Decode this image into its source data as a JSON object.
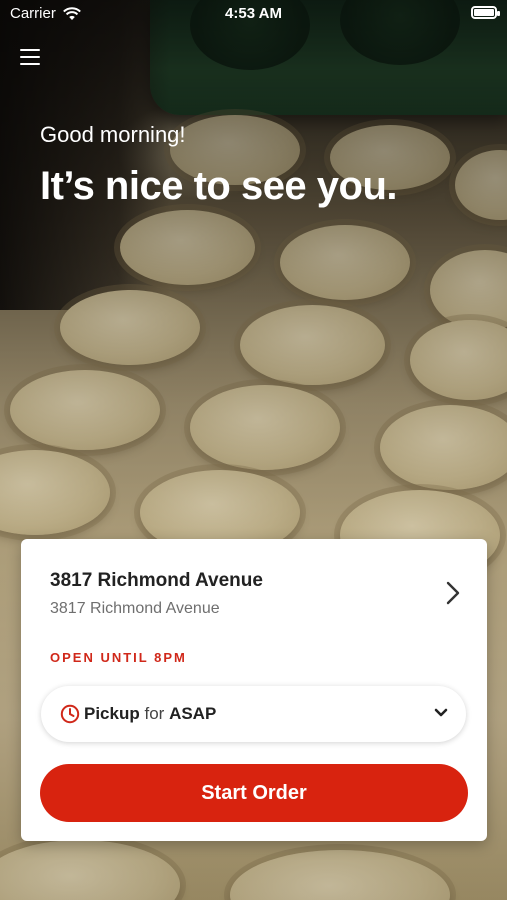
{
  "status_bar": {
    "carrier": "Carrier",
    "time": "4:53 AM"
  },
  "header": {
    "menu_icon": "hamburger-menu-icon"
  },
  "greeting": {
    "line1": "Good morning!",
    "line2": "It’s nice to see you."
  },
  "location_card": {
    "name": "3817 Richmond Avenue",
    "address": "3817 Richmond Avenue",
    "status": "OPEN UNTIL 8PM",
    "status_color": "#d0281a",
    "order_mode": {
      "type": "Pickup",
      "connector": "for",
      "time": "ASAP"
    },
    "cta_label": "Start Order",
    "cta_color": "#d8230f"
  }
}
